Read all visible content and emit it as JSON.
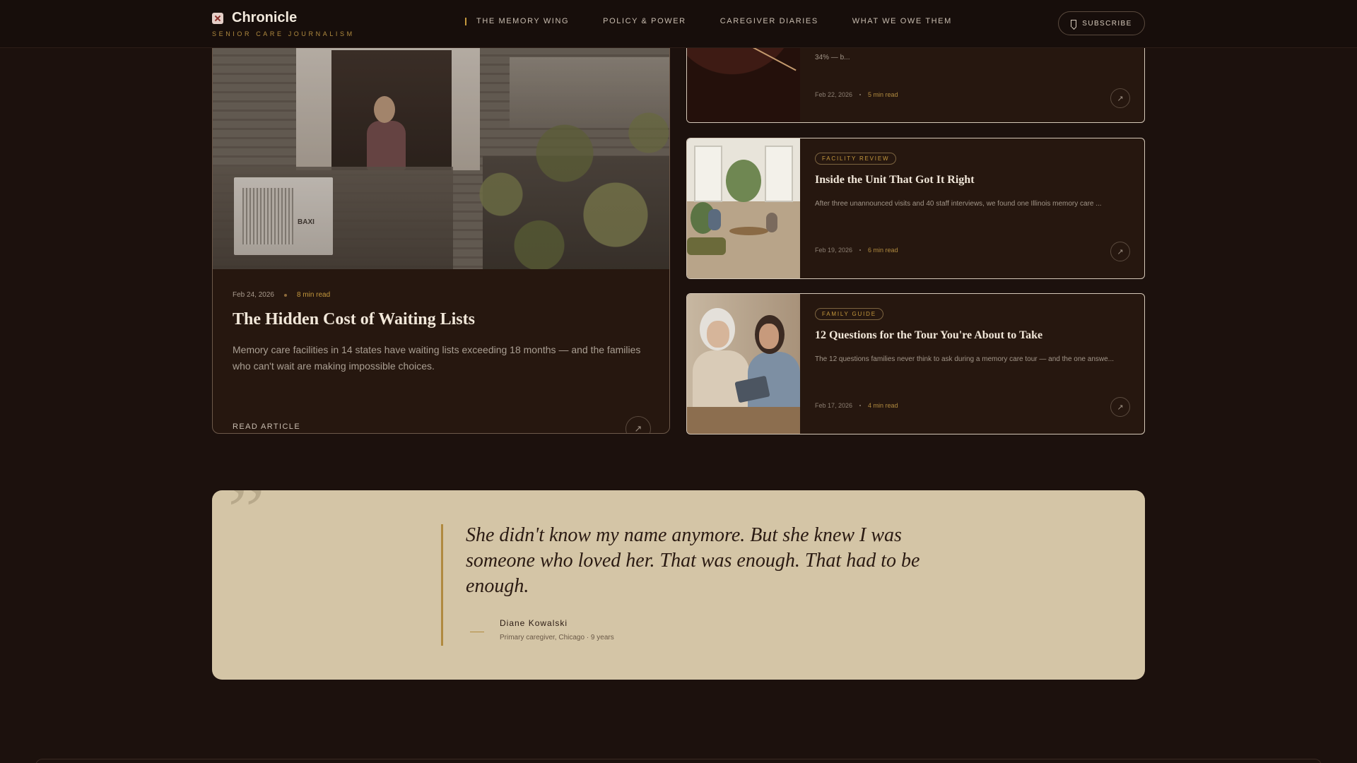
{
  "brand": {
    "name": "Chronicle",
    "tagline": "SENIOR CARE JOURNALISM"
  },
  "nav": {
    "items": [
      "THE MEMORY WING",
      "POLICY & POWER",
      "CAREGIVER DIARIES",
      "WHAT WE OWE THEM"
    ],
    "active_index": 0
  },
  "subscribe": {
    "label": "SUBSCRIBE"
  },
  "featured": {
    "date": "Feb 24, 2026",
    "read_time": "8 min read",
    "title": "The Hidden Cost of Waiting Lists",
    "excerpt": "Memory care facilities in 14 states have waiting lists exceeding 18 months — and the families who can't wait are making impossible choices.",
    "cta": "READ ARTICLE",
    "photo_text": "BAXI"
  },
  "side_cards": [
    {
      "tag": "",
      "title": "",
      "excerpt": "34% — b...",
      "date": "Feb 22, 2026",
      "read_time": "5 min read"
    },
    {
      "tag": "FACILITY REVIEW",
      "title": "Inside the Unit That Got It Right",
      "excerpt": "After three unannounced visits and 40 staff interviews, we found one Illinois memory care ...",
      "date": "Feb 19, 2026",
      "read_time": "6 min read"
    },
    {
      "tag": "FAMILY GUIDE",
      "title": "12 Questions for the Tour You're About to Take",
      "excerpt": "The 12 questions families never think to ask during a memory care tour — and the one answe...",
      "date": "Feb 17, 2026",
      "read_time": "4 min read"
    }
  ],
  "quote": {
    "text": "She didn't know my name anymore. But she knew I was someone who loved her. That was enough. That had to be enough.",
    "author": "Diane Kowalski",
    "role": "Primary caregiver, Chicago · 9 years"
  },
  "colors": {
    "background": "#1c110d",
    "card": "#26170f",
    "accent_gold": "#c4983d",
    "quote_panel": "#d4c5a6"
  },
  "icons": {
    "logo": "logo-mark-icon",
    "subscribe": "bookmark-icon",
    "card_link": "arrow-up-right-icon",
    "quote": "quote-mark-icon"
  }
}
